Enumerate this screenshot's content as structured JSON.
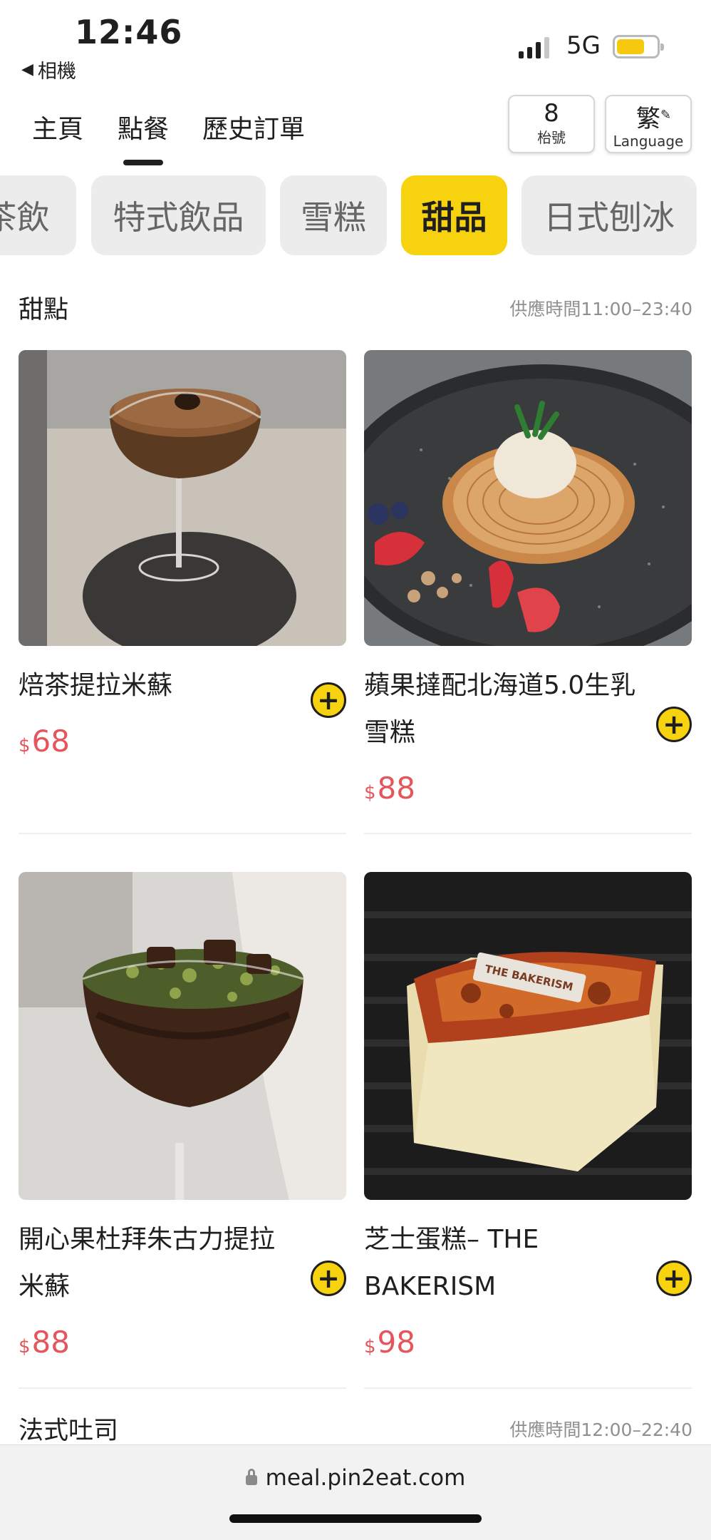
{
  "status_bar": {
    "time": "12:46",
    "back_app": "相機",
    "network": "5G"
  },
  "nav": {
    "tabs": [
      {
        "label": "主頁"
      },
      {
        "label": "點餐",
        "active": true
      },
      {
        "label": "歷史訂單"
      }
    ],
    "table_number": "8",
    "table_label": "枱號",
    "language_char": "繁",
    "language_label": "Language"
  },
  "categories": [
    {
      "label": "茶飲"
    },
    {
      "label": "特式飲品"
    },
    {
      "label": "雪糕"
    },
    {
      "label": "甜品",
      "active": true
    },
    {
      "label": "日式刨冰"
    }
  ],
  "sections": [
    {
      "title": "甜點",
      "hours": "供應時間11:00–23:40",
      "items": [
        {
          "name": "焙茶提拉米蘇",
          "currency": "$",
          "price": "68"
        },
        {
          "name": "蘋果撻配北海道5.0生乳雪糕",
          "currency": "$",
          "price": "88"
        },
        {
          "name": "開心果杜拜朱古力提拉米蘇",
          "currency": "$",
          "price": "88"
        },
        {
          "name": "芝士蛋糕– THE BAKERISM",
          "currency": "$",
          "price": "98"
        }
      ]
    },
    {
      "title": "法式吐司",
      "hours": "供應時間12:00–22:40"
    }
  ],
  "photo_labels": {
    "bakerism_tag": "THE BAKERISM"
  },
  "add_button_symbol": "+",
  "url_bar": {
    "url": "meal.pin2eat.com"
  },
  "colors": {
    "accent": "#f7d30f",
    "price": "#e5565c",
    "pill_bg": "#ececec"
  }
}
